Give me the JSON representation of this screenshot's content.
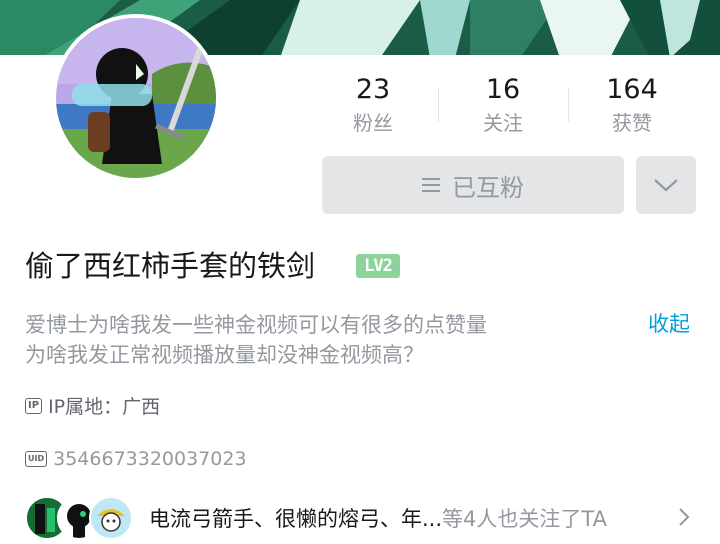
{
  "profile": {
    "name": "偷了西红柿手套的铁剑",
    "level_badge": "LV2",
    "signature_line1": "爱博士为啥我发一些神金视频可以有很多的点赞量",
    "signature_line2": "为啥我发正常视频播放量却没神金视频高？",
    "collapse_label": "收起",
    "ip_tag": "IP",
    "ip_location": "IP属地：广西",
    "uid_tag": "UID",
    "uid": "3546673320037023"
  },
  "stats": [
    {
      "value": "23",
      "label": "粉丝"
    },
    {
      "value": "16",
      "label": "关注"
    },
    {
      "value": "164",
      "label": "获赞"
    }
  ],
  "actions": {
    "mutual_follow_label": "已互粉"
  },
  "followers_row": {
    "names": "电流弓箭手、很懒的熔弓、年...",
    "suffix": "等4人也关注了TA"
  },
  "colors": {
    "accent": "#00a1d6",
    "level_badge": "#8bd29b",
    "button_bg": "#e3e5e7",
    "secondary_text": "#9499a0"
  }
}
